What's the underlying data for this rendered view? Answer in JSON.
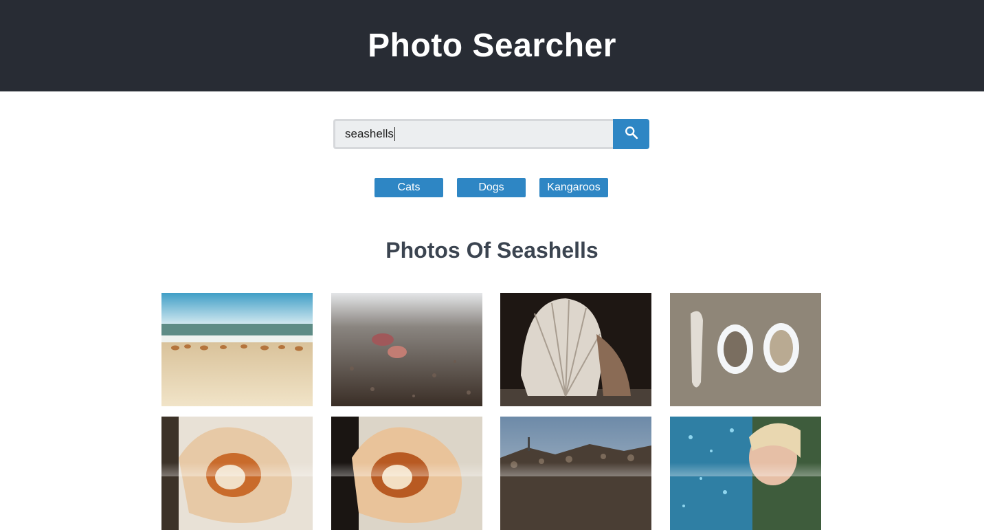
{
  "header": {
    "title": "Photo Searcher"
  },
  "search": {
    "value": "seashells",
    "icon": "search-icon"
  },
  "quick_tags": [
    {
      "label": "Cats"
    },
    {
      "label": "Dogs"
    },
    {
      "label": "Kangaroos"
    }
  ],
  "results": {
    "title": "Photos Of Seashells"
  },
  "colors": {
    "header_bg": "#282c34",
    "accent": "#2e86c4",
    "title_text": "#3b4450"
  }
}
